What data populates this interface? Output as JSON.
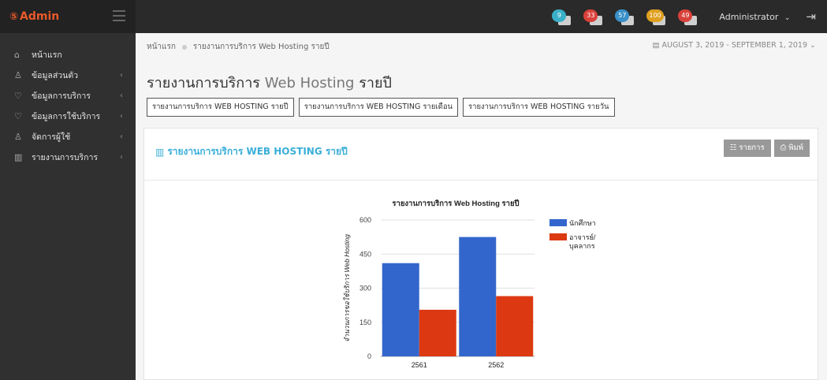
{
  "brand": {
    "logo_mark": "⑤",
    "name": "Admin"
  },
  "header": {
    "notifications": [
      {
        "badge": "9",
        "color": "#3ab0c8"
      },
      {
        "badge": "33",
        "color": "#d9413b"
      },
      {
        "badge": "57",
        "color": "#3a90c8"
      },
      {
        "badge": "100",
        "color": "#e0a020"
      },
      {
        "badge": "49",
        "color": "#d9413b"
      }
    ],
    "user_name": "Administrator",
    "user_caret": "⌄",
    "logout_icon": "⇥"
  },
  "sidebar": {
    "items": [
      {
        "label": "หน้าแรก",
        "icon": "⌂",
        "chevron": ""
      },
      {
        "label": "ข้อมูลส่วนตัว",
        "icon": "♙",
        "chevron": "‹"
      },
      {
        "label": "ข้อมูลการบริการ",
        "icon": "♡",
        "chevron": "‹"
      },
      {
        "label": "ข้อมูลการใช้บริการ",
        "icon": "♡",
        "chevron": "‹"
      },
      {
        "label": "จัดการผู้ใช้",
        "icon": "♙",
        "chevron": "‹"
      },
      {
        "label": "รายงานการบริการ",
        "icon": "▥",
        "chevron": "‹"
      }
    ]
  },
  "breadcrumb": {
    "home": "หน้าแรก",
    "current": "รายงานการบริการ Web Hosting รายปี"
  },
  "daterange": "▤ AUGUST 3, 2019 - SEPTEMBER 1, 2019 ⌄",
  "page": {
    "title_a": "รายงานการบริการ",
    "title_b": "Web Hosting",
    "title_c": "รายปี"
  },
  "tabs": [
    "รายงานการบริการ WEB HOSTING รายปี",
    "รายงานการบริการ WEB HOSTING รายเดือน",
    "รายงานการบริการ WEB HOSTING รายวัน"
  ],
  "panel": {
    "title": "รายงานการบริการ WEB HOSTING รายปี",
    "title_icon": "▥",
    "btn_list": "☷ รายการ",
    "btn_print": "⎙ พิมพ์"
  },
  "chart_data": {
    "type": "bar",
    "title": "รายงานการบริการ Web Hosting รายปี",
    "ylabel": "จำนวนการขอใช้บริการ Web Hosting",
    "categories": [
      "2561",
      "2562"
    ],
    "series": [
      {
        "name": "นักศึกษา",
        "values": [
          410,
          525
        ],
        "color": "#3366cc"
      },
      {
        "name": "อาจารย์/ บุคลากร",
        "values": [
          205,
          265
        ],
        "color": "#dc3912"
      }
    ],
    "ylim": [
      0,
      600
    ],
    "yticks": [
      0,
      150,
      300,
      450,
      600
    ],
    "grid": true,
    "legend": "right"
  }
}
